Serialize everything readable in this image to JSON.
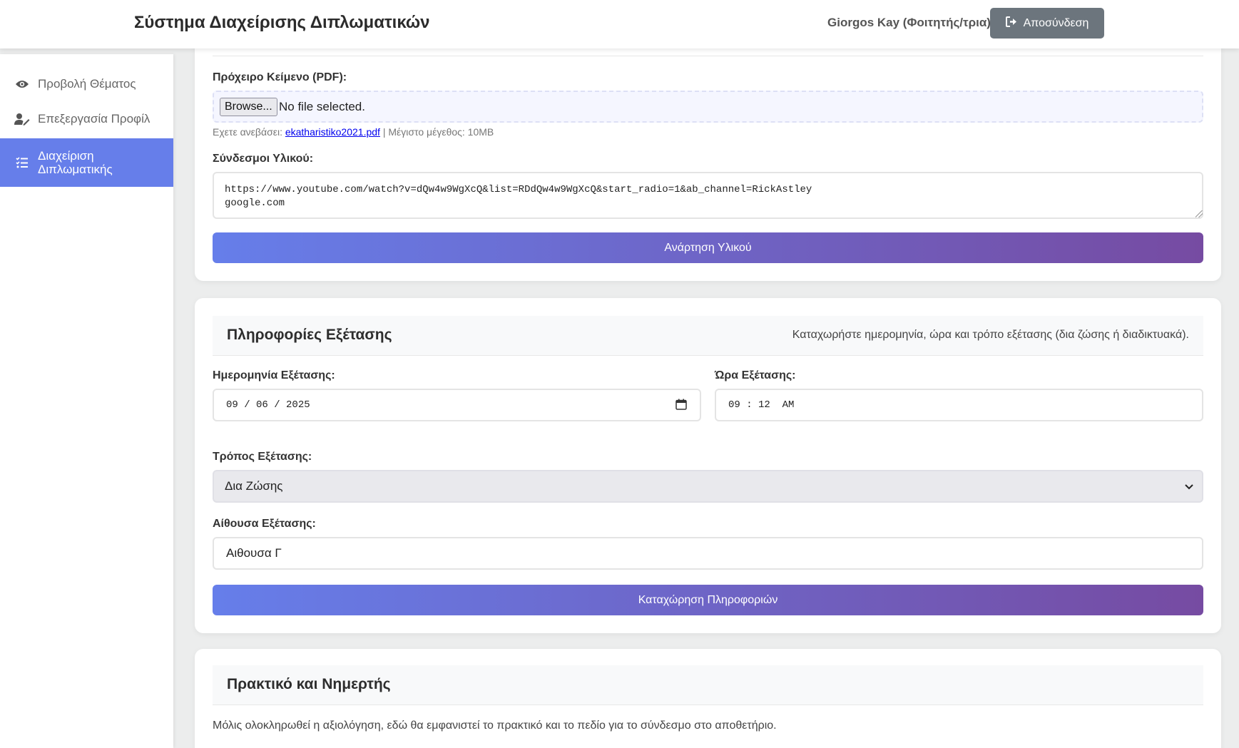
{
  "header": {
    "title": "Σύστημα Διαχείρισης Διπλωματικών",
    "user": "Giorgos Kay (Φοιτητής/τρια)",
    "logout_label": "Αποσύνδεση"
  },
  "sidebar": {
    "items": [
      {
        "label": "Προβολή Θέματος",
        "icon": "eye-icon"
      },
      {
        "label": "Επεξεργασία Προφίλ",
        "icon": "user-edit-icon"
      },
      {
        "label": "Διαχείριση\nΔιπλωματικής",
        "icon": "tasks-icon",
        "active": true
      }
    ]
  },
  "material": {
    "draft_label": "Πρόχειρο Κείμενο (PDF):",
    "browse_label": "Browse...",
    "file_status": "No file selected.",
    "uploaded_prefix": "Εχετε ανεβάσει:",
    "uploaded_file": "ekatharistiko2021.pdf",
    "max_size": "| Μέγιστο μέγεθος: 10MB",
    "links_label": "Σύνδεσμοι Υλικού:",
    "links_value": "https://www.youtube.com/watch?v=dQw4w9WgXcQ&list=RDdQw4w9WgXcQ&start_radio=1&ab_channel=RickAstley\ngoogle.com",
    "submit_label": "Ανάρτηση Υλικού"
  },
  "exam": {
    "title": "Πληροφορίες Εξέτασης",
    "hint": "Καταχωρήστε ημερομηνία, ώρα και τρόπο εξέτασης (δια ζώσης ή διαδικτυακά).",
    "date_label": "Ημερομηνία Εξέτασης:",
    "date_value": "09 / 06 / 2025",
    "time_label": "Ώρα Εξέτασης:",
    "time_value": "09 : 12  AM",
    "mode_label": "Τρόπος Εξέτασης:",
    "mode_value": "Δια Ζώσης",
    "room_label": "Αίθουσα Εξέτασης:",
    "room_value": "Αιθουσα Γ",
    "submit_label": "Καταχώρηση Πληροφοριών"
  },
  "record": {
    "title": "Πρακτικό και Νημερτής",
    "text": "Μόλις ολοκληρωθεί η αξιολόγηση, εδώ θα εμφανιστεί το πρακτικό και το πεδίο για το σύνδεσμο στο αποθετήριο."
  }
}
